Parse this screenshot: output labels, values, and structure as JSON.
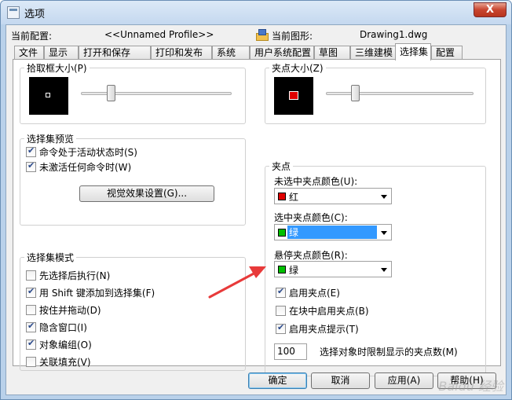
{
  "window": {
    "title": "选项",
    "close_glyph": "X"
  },
  "header": {
    "current_profile_label": "当前配置:",
    "current_profile_value": "<<Unnamed Profile>>",
    "current_drawing_label": "当前图形:",
    "current_drawing_value": "Drawing1.dwg"
  },
  "tabs": [
    {
      "label": "文件"
    },
    {
      "label": "显示"
    },
    {
      "label": "打开和保存"
    },
    {
      "label": "打印和发布"
    },
    {
      "label": "系统"
    },
    {
      "label": "用户系统配置"
    },
    {
      "label": "草图"
    },
    {
      "label": "三维建模"
    },
    {
      "label": "选择集",
      "active": true
    },
    {
      "label": "配置"
    }
  ],
  "pickbox": {
    "title": "拾取框大小(P)",
    "slider_level": 0.18
  },
  "grip_size": {
    "title": "夹点大小(Z)",
    "slider_level": 0.18,
    "color": "#e00000"
  },
  "selection_preview": {
    "title": "选择集预览",
    "options": [
      {
        "label": "命令处于活动状态时(S)",
        "checked": true
      },
      {
        "label": "未激活任何命令时(W)",
        "checked": true
      }
    ],
    "visual_effects_button": "视觉效果设置(G)..."
  },
  "selection_modes": {
    "title": "选择集模式",
    "options": [
      {
        "label": "先选择后执行(N)",
        "checked": false
      },
      {
        "label": "用 Shift 键添加到选择集(F)",
        "checked": true
      },
      {
        "label": "按住并拖动(D)",
        "checked": false
      },
      {
        "label": "隐含窗口(I)",
        "checked": true
      },
      {
        "label": "对象编组(O)",
        "checked": true
      },
      {
        "label": "关联填充(V)",
        "checked": false
      }
    ]
  },
  "grips": {
    "title": "夹点",
    "unselected_color_label": "未选中夹点颜色(U):",
    "unselected_color_value": "红",
    "unselected_color_hex": "#e00000",
    "selected_color_label": "选中夹点颜色(C):",
    "selected_color_value": "绿",
    "selected_color_hex": "#00c000",
    "hover_color_label": "悬停夹点颜色(R):",
    "hover_color_value": "绿",
    "hover_color_hex": "#00c000",
    "options": [
      {
        "label": "启用夹点(E)",
        "checked": true
      },
      {
        "label": "在块中启用夹点(B)",
        "checked": false
      },
      {
        "label": "启用夹点提示(T)",
        "checked": true
      }
    ],
    "limit_value": "100",
    "limit_label": "选择对象时限制显示的夹点数(M)"
  },
  "footer": {
    "ok": "确定",
    "cancel": "取消",
    "apply": "应用(A)",
    "help": "帮助(H)"
  },
  "annotation_color": "#e83a3a",
  "watermark": "Baidu 经验"
}
